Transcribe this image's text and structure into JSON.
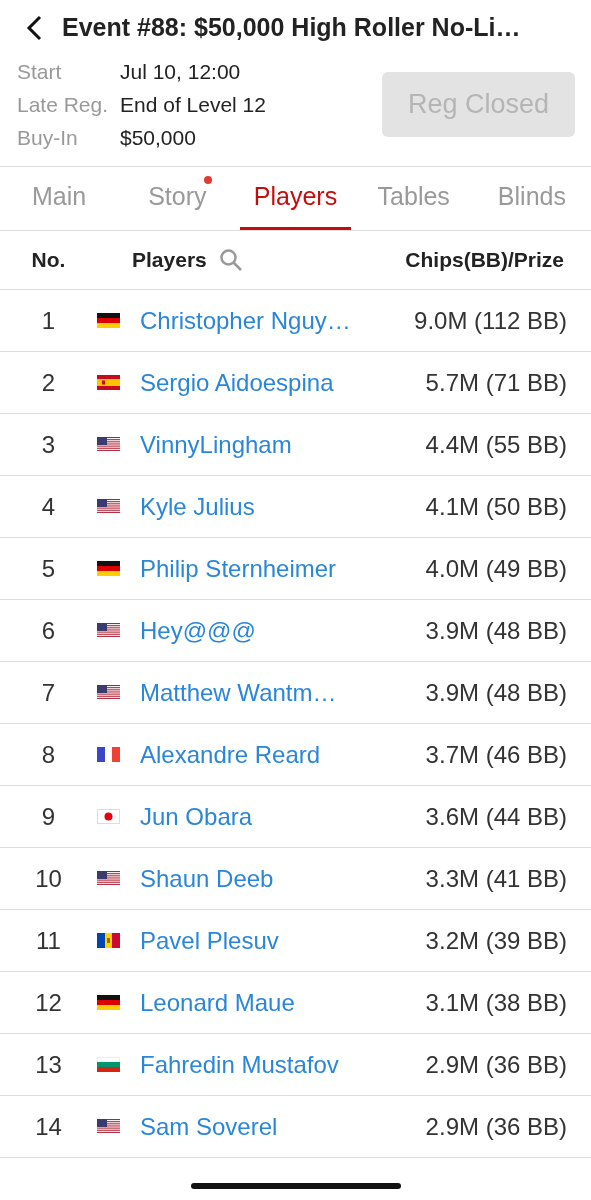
{
  "header": {
    "title": "Event #88: $50,000 High Roller No-Li…"
  },
  "info": [
    {
      "label": "Start",
      "value": "Jul 10, 12:00"
    },
    {
      "label": "Late Reg.",
      "value": "End of Level 12"
    },
    {
      "label": "Buy-In",
      "value": "$50,000"
    }
  ],
  "reg_button": {
    "label": "Reg Closed",
    "disabled": true
  },
  "tabs": [
    {
      "label": "Main",
      "selected": false,
      "dot": false
    },
    {
      "label": "Story",
      "selected": false,
      "dot": true
    },
    {
      "label": "Players",
      "selected": true,
      "dot": false
    },
    {
      "label": "Tables",
      "selected": false,
      "dot": false
    },
    {
      "label": "Blinds",
      "selected": false,
      "dot": false
    }
  ],
  "table": {
    "columns": [
      "No.",
      "Players",
      "Chips(BB)/Prize"
    ],
    "rows": [
      {
        "no": "1",
        "kind": "de",
        "name": "Christopher Nguy…",
        "chips": "9.0M (112 BB)"
      },
      {
        "no": "2",
        "kind": "es",
        "name": "Sergio Aidoespina",
        "chips": "5.7M (71 BB)"
      },
      {
        "no": "3",
        "kind": "us",
        "name": "VinnyLingham",
        "chips": "4.4M (55 BB)"
      },
      {
        "no": "4",
        "kind": "us",
        "name": "Kyle Julius",
        "chips": "4.1M (50 BB)"
      },
      {
        "no": "5",
        "kind": "de",
        "name": "Philip Sternheimer",
        "chips": "4.0M (49 BB)"
      },
      {
        "no": "6",
        "kind": "us",
        "name": "Hey@@@",
        "chips": "3.9M (48 BB)"
      },
      {
        "no": "7",
        "kind": "us",
        "name": "Matthew Wantm…",
        "chips": "3.9M (48 BB)"
      },
      {
        "no": "8",
        "kind": "fr",
        "name": "Alexandre Reard",
        "chips": "3.7M (46 BB)"
      },
      {
        "no": "9",
        "kind": "jp",
        "name": "Jun Obara",
        "chips": "3.6M (44 BB)"
      },
      {
        "no": "10",
        "kind": "us",
        "name": "Shaun Deeb",
        "chips": "3.3M (41 BB)"
      },
      {
        "no": "11",
        "kind": "md",
        "name": "Pavel Plesuv",
        "chips": "3.2M (39 BB)"
      },
      {
        "no": "12",
        "kind": "de",
        "name": "Leonard Maue",
        "chips": "3.1M (38 BB)"
      },
      {
        "no": "13",
        "kind": "bg",
        "name": "Fahredin Mustafov",
        "chips": "2.9M (36 BB)"
      },
      {
        "no": "14",
        "kind": "us",
        "name": "Sam Soverel",
        "chips": "2.9M (36 BB)"
      }
    ]
  }
}
